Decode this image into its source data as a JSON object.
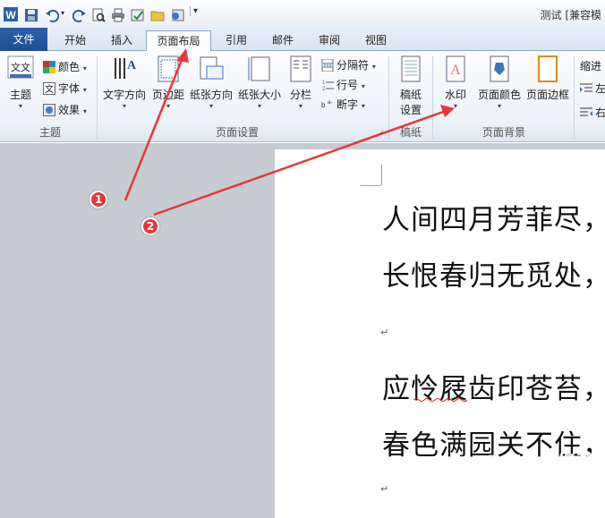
{
  "window": {
    "title": "测试 [兼容模"
  },
  "tabs": [
    {
      "label": "文件"
    },
    {
      "label": "开始"
    },
    {
      "label": "插入"
    },
    {
      "label": "页面布局"
    },
    {
      "label": "引用"
    },
    {
      "label": "邮件"
    },
    {
      "label": "审阅"
    },
    {
      "label": "视图"
    }
  ],
  "ribbon": {
    "theme": {
      "main": "主题",
      "colors": "颜色",
      "fonts": "字体",
      "effects": "效果",
      "group": "主题"
    },
    "page_setup": {
      "text_direction": "文字方向",
      "margins": "页边距",
      "orientation": "纸张方向",
      "size": "纸张大小",
      "columns": "分栏",
      "breaks": "分隔符",
      "line_numbers": "行号",
      "hyphenation": "断字",
      "group": "页面设置"
    },
    "draft": {
      "paper": "稿纸",
      "settings": "设置",
      "group": "稿纸"
    },
    "page_background": {
      "watermark": "水印",
      "page_color": "页面颜色",
      "page_borders": "页面边框",
      "group": "页面背景"
    },
    "paragraph": {
      "indent": "缩进",
      "left": "左",
      "right": "右"
    }
  },
  "document": {
    "lines": [
      "人间四月芳菲尽，",
      "长恨春归无觅处，",
      "应怜屐齿印苍苔，",
      "春色满园关不住，"
    ],
    "paragraph_mark": "↵"
  },
  "annotations": {
    "badge1": "1",
    "badge2": "2",
    "arrow_color": "#e8373a"
  },
  "watermark": {
    "text": "Baidu 经验",
    "sub": "jingyan.baidu.com"
  }
}
